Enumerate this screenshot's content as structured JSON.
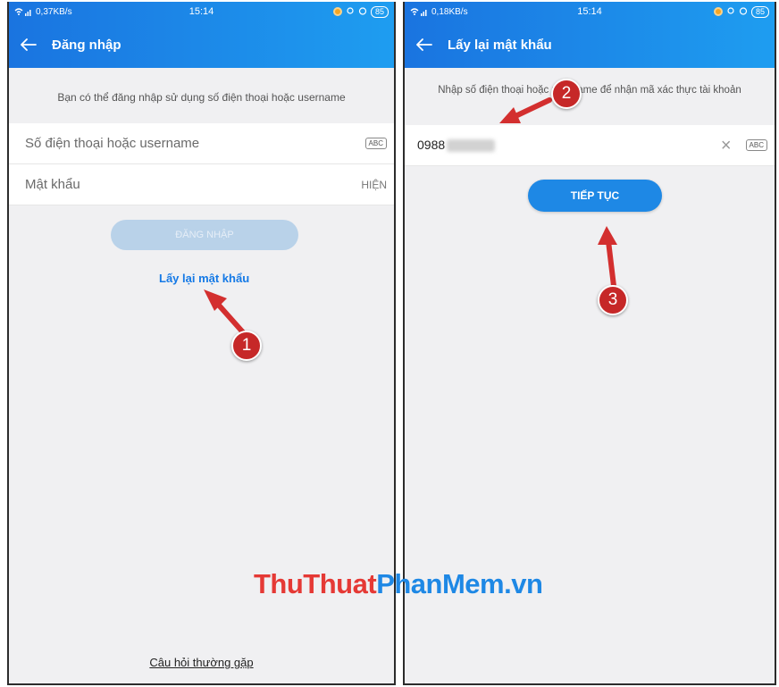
{
  "left_screen": {
    "status": {
      "speed": "0,37KB/s",
      "time": "15:14",
      "battery": "85"
    },
    "title": "Đăng nhập",
    "helper": "Bạn có thể đăng nhập sử dụng số điện thoại hoặc username",
    "username_placeholder": "Số điện thoại hoặc username",
    "keyboard_badge": "ABC",
    "password_placeholder": "Mật khẩu",
    "show_password": "HIỆN",
    "login_button": "ĐĂNG NHẬP",
    "forgot_link": "Lấy lại mật khẩu",
    "faq_link": "Câu hỏi thường gặp"
  },
  "right_screen": {
    "status": {
      "speed": "0,18KB/s",
      "time": "15:14",
      "battery": "85"
    },
    "title": "Lấy lại mật khẩu",
    "helper": "Nhập số điện thoại hoặc username để nhận mã xác thực tài khoản",
    "phone_value": "0988",
    "keyboard_badge": "ABC",
    "continue_button": "TIẾP TỤC"
  },
  "annotations": {
    "step1": "1",
    "step2": "2",
    "step3": "3",
    "arrow_color": "#d32f2f"
  },
  "watermark": {
    "part1": "ThuThuat",
    "part2": "PhanMem.vn"
  },
  "colors": {
    "header_start": "#1a74e0",
    "header_end": "#1e9df0",
    "primary": "#1e88e5",
    "link": "#1479e6"
  }
}
